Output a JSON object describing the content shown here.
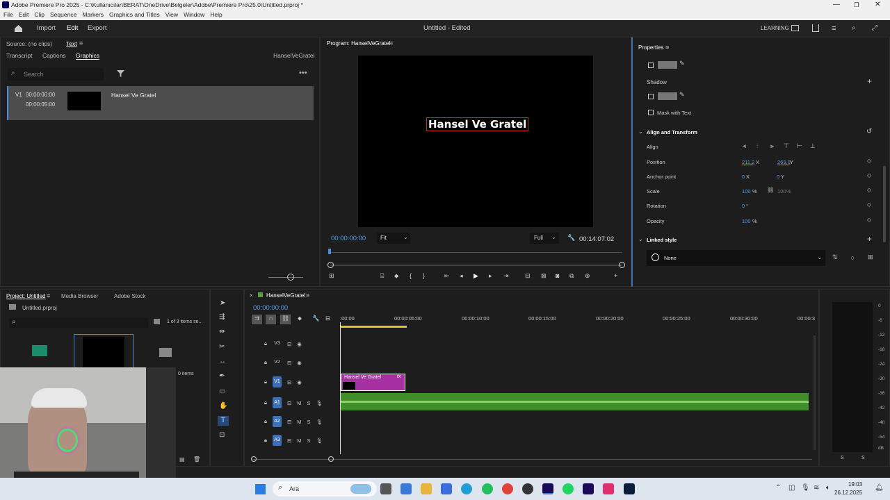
{
  "window": {
    "title": "Adobe Premiere Pro 2025 - C:\\Kullanıcılar\\BERAT\\OneDrive\\Belgeler\\Adobe\\Premiere Pro\\25.0\\Untitled.prproj *"
  },
  "menu": [
    "File",
    "Edit",
    "Clip",
    "Sequence",
    "Markers",
    "Graphics and Titles",
    "View",
    "Window",
    "Help"
  ],
  "appbar": {
    "import": "Import",
    "edit": "Edit",
    "export": "Export",
    "project_status": "Untitled - Edited",
    "workspace": "LEARNING"
  },
  "source_panel": {
    "source": "Source: (no clips)",
    "text_tab": "Text",
    "tabs": [
      "Transcript",
      "Captions",
      "Graphics"
    ],
    "sequence_name": "HanselVeGratel",
    "search_placeholder": "Search",
    "item": {
      "track": "V1",
      "start": "00:00:00:00",
      "end": "00:00:05:00",
      "label": "Hansel Ve Gratel"
    }
  },
  "program_monitor": {
    "title": "Program: HanselVeGratel",
    "overlay_text": "Hansel Ve Gratel",
    "timecode": "00:00:00:00",
    "fit": "Fit",
    "resolution": "Full",
    "duration": "00:14:07:02"
  },
  "properties": {
    "title": "Properties",
    "shadow": "Shadow",
    "mask_with_text": "Mask with Text",
    "align_transform": "Align and Transform",
    "align": "Align",
    "position_label": "Position",
    "position_x": "211,2",
    "position_x_unit": "X",
    "position_y": "269,0",
    "position_y_unit": "Y",
    "anchor_label": "Anchor point",
    "anchor_x": "0",
    "anchor_x_unit": "X",
    "anchor_y": "0",
    "anchor_y_unit": "Y",
    "scale_label": "Scale",
    "scale_value": "100",
    "scale_value2": "100",
    "percent": "%",
    "rotation_label": "Rotation",
    "rotation_value": "0",
    "rotation_unit": "°",
    "opacity_label": "Opacity",
    "opacity_value": "100",
    "opacity_unit": "%",
    "linked_style": "Linked style",
    "style_value": "None",
    "style_count": "0"
  },
  "project_panel": {
    "tabs": [
      "Project: Untitled",
      "Media Browser",
      "Adobe Stock"
    ],
    "file": "Untitled.prproj",
    "items_count": "1 of 3 items se...",
    "items_label": "0 items"
  },
  "timeline": {
    "sequence": "HanselVeGratel",
    "timecode": "00:00:00:00",
    "ruler": [
      ":00:00",
      "00:00:05:00",
      "00:00:10:00",
      "00:00:15:00",
      "00:00:20:00",
      "00:00:25:00",
      "00:00:30:00",
      "00:00:3"
    ],
    "video_tracks": [
      "V3",
      "V2",
      "V1"
    ],
    "audio_tracks": [
      "A1",
      "A2",
      "A3"
    ],
    "track_m": "M",
    "track_s": "S",
    "clip_label": "Hansel Ve Gratel",
    "clip_fx": "fx"
  },
  "meters": {
    "labels": [
      "0",
      "-6",
      "-12",
      "-18",
      "-24",
      "-30",
      "-36",
      "-42",
      "-48",
      "-54"
    ],
    "unit": "dB",
    "solo_l": "S",
    "solo_r": "S"
  },
  "taskbar": {
    "search": "Ara",
    "time": "19:03",
    "date": "26.12.2025"
  }
}
